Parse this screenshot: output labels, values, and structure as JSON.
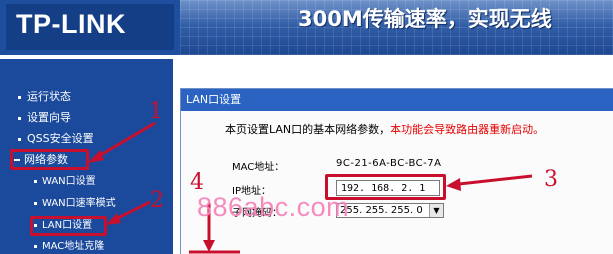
{
  "header": {
    "logo": "TP-LINK",
    "banner_text": "300M传输速率，实现无线"
  },
  "sidebar": {
    "items": [
      {
        "label": "运行状态"
      },
      {
        "label": "设置向导"
      },
      {
        "label": "QSS安全设置"
      },
      {
        "label": "网络参数"
      }
    ],
    "sub_items": [
      {
        "label": "WAN口设置"
      },
      {
        "label": "WAN口速率模式"
      },
      {
        "label": "LAN口设置"
      },
      {
        "label": "MAC地址克隆"
      }
    ]
  },
  "panel": {
    "title": "LAN口设置",
    "desc_prefix": "本页设置LAN口的基本网络参数，",
    "desc_warning": "本功能会导致路由器重新启动。",
    "mac_label": "MAC地址：",
    "mac_value": "9C-21-6A-BC-BC-7A",
    "ip_label": "IP地址：",
    "ip_value": "192. 168. 2. 1",
    "mask_label": "子网掩码：",
    "mask_value": "255. 255. 255. 0"
  },
  "annotations": {
    "labels": [
      "1",
      "2",
      "3",
      "4"
    ],
    "color": "#c8102e"
  },
  "watermark": "886abc.com",
  "colors": {
    "sidebar_bg": "#1b4a9c",
    "panel_title_bg": "#2a63c2",
    "warning_text": "#e60000",
    "annotation": "#c8102e"
  }
}
